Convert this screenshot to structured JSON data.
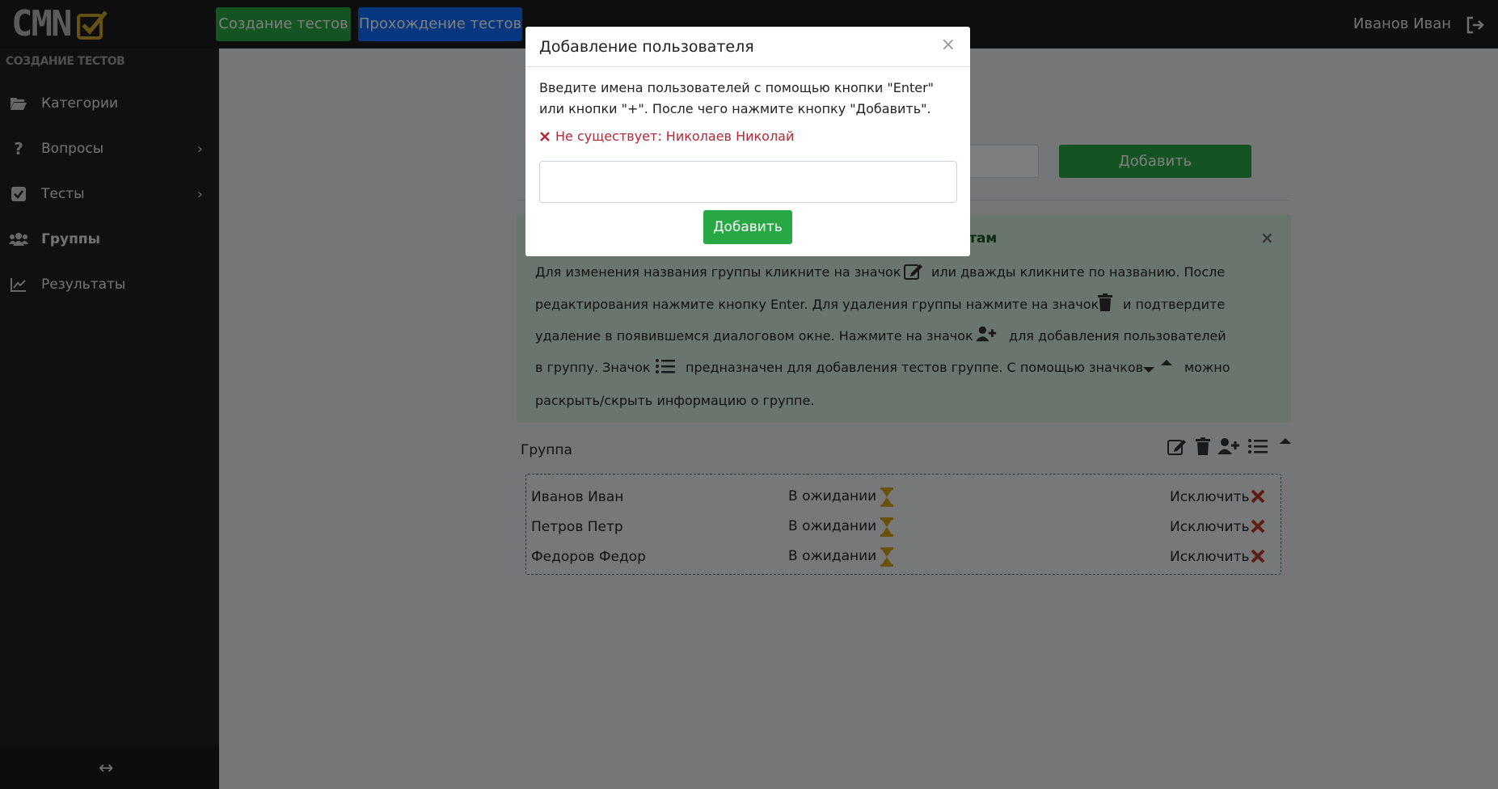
{
  "navbar": {
    "logo_text": "CMN",
    "create_tests": "Создание тестов",
    "pass_tests": "Прохождение тестов",
    "user_name": "Иванов Иван"
  },
  "sidebar": {
    "heading": "СОЗДАНИЕ ТЕСТОВ",
    "items": [
      {
        "label": "Категории",
        "icon": "folder-open-icon"
      },
      {
        "label": "Вопросы",
        "icon": "question-icon"
      },
      {
        "label": "Тесты",
        "icon": "check-square-icon"
      },
      {
        "label": "Группы",
        "icon": "users-icon"
      },
      {
        "label": "Результаты",
        "icon": "chart-line-icon"
      }
    ]
  },
  "main": {
    "add_group_button": "Добавить",
    "info": {
      "title_visible_fragment": "стам",
      "lines": [
        "Для изменения названия группы кликните на значок",
        "или дважды кликните по названию. После",
        "редактирования нажмите кнопку Enter. Для удаления группы нажмите на значок",
        "и подтвердите",
        "удаление в появившемся диалоговом окне. Нажмите на значок",
        "для добавления пользователей",
        "в группу. Значок",
        "предназначен для добавления тестов группе. С помощью значков",
        "можно",
        "раскрыть/скрыть информацию о группе."
      ]
    },
    "group": {
      "name": "Группа",
      "members": [
        {
          "name": "Иванов Иван",
          "status": "В ожидании",
          "action": "Исключить"
        },
        {
          "name": "Петров Петр",
          "status": "В ожидании",
          "action": "Исключить"
        },
        {
          "name": "Федоров Федор",
          "status": "В ожидании",
          "action": "Исключить"
        }
      ]
    }
  },
  "modal": {
    "title": "Добавление пользователя",
    "close": "×",
    "text": "Введите имена пользователей с помощью кнопки \"Enter\" или кнопки \"+\". После чего нажмите кнопку \"Добавить\".",
    "error": "Не существует: Николаев Николай",
    "input_value": "",
    "add_button": "Добавить"
  },
  "colors": {
    "accent_green": "#28a745",
    "accent_blue": "#0d6efd",
    "error_red": "#b02a37",
    "navbar_bg": "#1c1c1c",
    "sidebar_bg": "#212121"
  }
}
